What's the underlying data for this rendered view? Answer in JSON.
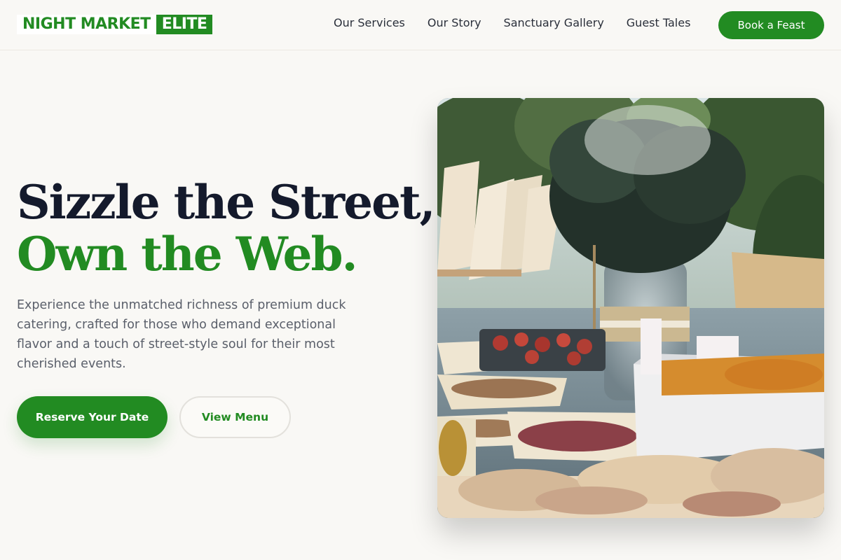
{
  "header": {
    "logo_part1": "NIGHT MARKET",
    "logo_part2": "ELITE",
    "nav": [
      "Our Services",
      "Our Story",
      "Sanctuary Gallery",
      "Guest Tales"
    ],
    "cta_label": "Book a Feast"
  },
  "hero": {
    "headline_line1": "Sizzle the Street,",
    "headline_line2": "Own the Web.",
    "lead": "Experience the unmatched richness of premium duck catering, crafted for those who demand exceptional flavor and a touch of street-style soul for their most cherished events.",
    "primary_button": "Reserve Your Date",
    "secondary_button": "View Menu"
  },
  "colors": {
    "brand_green": "#228b22",
    "background": "#f9f8f5",
    "headline_dark": "#141a2c"
  },
  "photo": {
    "subject": "outdoor catering buffet table with flower vase, paper cones, snacks and sandwiches"
  }
}
